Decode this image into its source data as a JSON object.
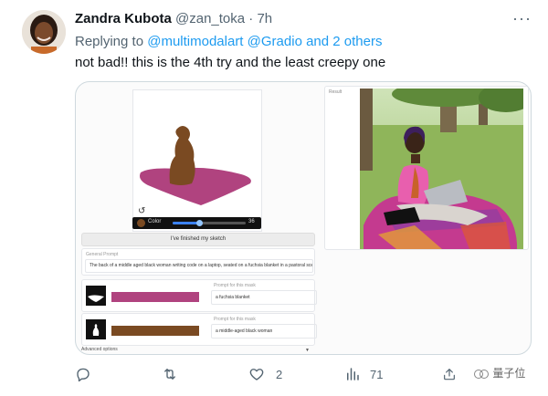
{
  "tweet": {
    "author_name": "Zandra Kubota",
    "handle": "@zan_toka",
    "separator": "·",
    "time": "7h",
    "more_icon": "more-horizontal-icon",
    "replying_prefix": "Replying to",
    "mention_1": "@multimodalart",
    "mention_2": "@Gradio",
    "mention_others": "and 2 others",
    "text": "not bad!! this is the 4th try and the least creepy one"
  },
  "gradio": {
    "color_label": "Color",
    "brush_size": "36",
    "finish_button": "I've finished my sketch",
    "general_prompt_label": "General Prompt",
    "general_prompt_value": "The back of a middle aged black woman writing code on a laptop, seated on a fuchsia blanket in a pastoral scene",
    "masks": [
      {
        "label": "Prompt for this mask",
        "value": "a fuchsia blanket",
        "color": "#b0437f"
      },
      {
        "label": "Prompt for this mask",
        "value": "a middle-aged black woman",
        "color": "#7a4a22"
      }
    ],
    "advanced_options": "Advanced options",
    "result_label": "Result"
  },
  "actions": {
    "reply_icon": "reply-icon",
    "retweet_icon": "retweet-icon",
    "like_icon": "heart-icon",
    "like_count": "2",
    "views_icon": "views-icon",
    "views_count": "71",
    "share_icon": "share-icon"
  },
  "watermark": "量子位",
  "colors": {
    "link": "#1d9bf0",
    "secondary_text": "#536471",
    "primary_text": "#0f1419",
    "fuchsia": "#b0437f",
    "brown": "#7a4a22"
  }
}
